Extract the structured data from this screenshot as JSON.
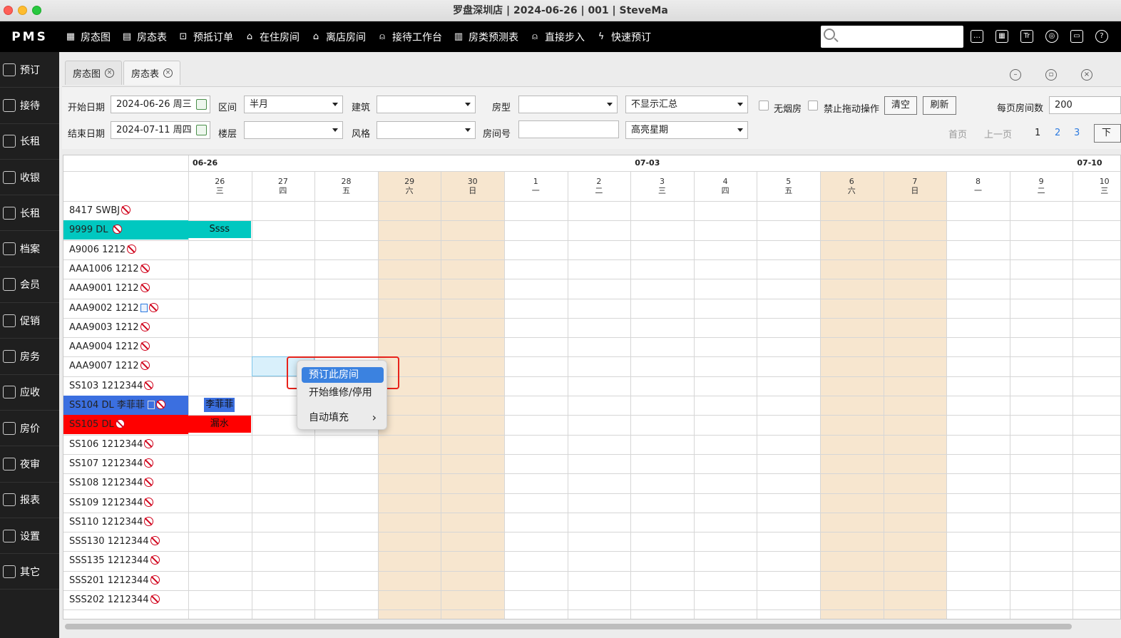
{
  "window": {
    "title": "罗盘深圳店 | 2024-06-26 | 001 | SteveMa"
  },
  "topnav": {
    "logo": "PMS",
    "items": [
      {
        "label": "房态图",
        "icon": "grid-icon",
        "glyph": "▦"
      },
      {
        "label": "房态表",
        "icon": "document-icon",
        "glyph": "▤"
      },
      {
        "label": "预抵订单",
        "icon": "inbox-icon",
        "glyph": "⊡"
      },
      {
        "label": "在住房间",
        "icon": "house-icon",
        "glyph": "⌂"
      },
      {
        "label": "离店房间",
        "icon": "house-out-icon",
        "glyph": "⌂"
      },
      {
        "label": "接待工作台",
        "icon": "reception-icon",
        "glyph": "⍝"
      },
      {
        "label": "房类预测表",
        "icon": "calendar-icon",
        "glyph": "▥"
      },
      {
        "label": "直接步入",
        "icon": "walk-in-icon",
        "glyph": "⍝"
      },
      {
        "label": "快速预订",
        "icon": "lightning-icon",
        "glyph": "ϟ"
      }
    ],
    "right_icons": [
      "message-icon",
      "calculator-icon",
      "font-icon",
      "globe-icon",
      "lock-icon",
      "help-icon"
    ]
  },
  "sidebar": {
    "items": [
      "预订",
      "接待",
      "长租",
      "收银",
      "长租",
      "档案",
      "会员",
      "促销",
      "房务",
      "应收",
      "房价",
      "夜审",
      "报表",
      "设置",
      "其它"
    ]
  },
  "tabs": [
    {
      "label": "房态图",
      "active": false
    },
    {
      "label": "房态表",
      "active": true
    }
  ],
  "filters": {
    "start_date_label": "开始日期",
    "start_date": "2024-06-26 周三",
    "end_date_label": "结束日期",
    "end_date": "2024-07-11 周四",
    "range_label": "区间",
    "range": "半月",
    "floor_label": "楼层",
    "floor": "",
    "building_label": "建筑",
    "building": "",
    "style_label": "风格",
    "style": "",
    "roomtype_label": "房型",
    "roomtype": "",
    "roomno_label": "房间号",
    "roomno": "",
    "summary": "不显示汇总",
    "highlight": "高亮星期",
    "no_smoking_label": "无烟房",
    "no_drag_label": "禁止拖动操作",
    "clear_btn": "清空",
    "refresh_btn": "刷新",
    "per_page_label": "每页房间数",
    "per_page": "200",
    "first_page": "首页",
    "prev_page": "上一页",
    "pages": [
      "1",
      "2",
      "3"
    ],
    "next_page": "下"
  },
  "grid": {
    "weeks": [
      "06-26",
      "07-03",
      "07-10"
    ],
    "days": [
      {
        "d": "26",
        "w": "三",
        "weekend": false
      },
      {
        "d": "27",
        "w": "四",
        "weekend": false
      },
      {
        "d": "28",
        "w": "五",
        "weekend": false
      },
      {
        "d": "29",
        "w": "六",
        "weekend": true
      },
      {
        "d": "30",
        "w": "日",
        "weekend": true
      },
      {
        "d": "1",
        "w": "一",
        "weekend": false
      },
      {
        "d": "2",
        "w": "二",
        "weekend": false
      },
      {
        "d": "3",
        "w": "三",
        "weekend": false
      },
      {
        "d": "4",
        "w": "四",
        "weekend": false
      },
      {
        "d": "5",
        "w": "五",
        "weekend": false
      },
      {
        "d": "6",
        "w": "六",
        "weekend": true
      },
      {
        "d": "7",
        "w": "日",
        "weekend": true
      },
      {
        "d": "8",
        "w": "一",
        "weekend": false
      },
      {
        "d": "9",
        "w": "二",
        "weekend": false
      },
      {
        "d": "10",
        "w": "三",
        "weekend": false
      }
    ],
    "rooms": [
      {
        "name": "8417 SWBJ",
        "bg": ""
      },
      {
        "name": "9999 DL ",
        "bg": "#00c8c0"
      },
      {
        "name": "A9006 1212",
        "bg": ""
      },
      {
        "name": "AAA1006 1212",
        "bg": ""
      },
      {
        "name": "AAA9001 1212",
        "bg": ""
      },
      {
        "name": "AAA9002 1212",
        "bg": "",
        "note": true
      },
      {
        "name": "AAA9003 1212",
        "bg": ""
      },
      {
        "name": "AAA9004 1212",
        "bg": ""
      },
      {
        "name": "AAA9007 1212",
        "bg": ""
      },
      {
        "name": "SS103 1212344",
        "bg": ""
      },
      {
        "name": "SS104 DL  李菲菲",
        "bg": "#3b6fe0",
        "trash": true
      },
      {
        "name": "SS105 DL",
        "bg": "#ff0000"
      },
      {
        "name": "SS106 1212344",
        "bg": ""
      },
      {
        "name": "SS107 1212344",
        "bg": ""
      },
      {
        "name": "SS108 1212344",
        "bg": ""
      },
      {
        "name": "SS109 1212344",
        "bg": ""
      },
      {
        "name": "SS110 1212344",
        "bg": ""
      },
      {
        "name": "SSS130 1212344",
        "bg": ""
      },
      {
        "name": "SSS135 1212344",
        "bg": ""
      },
      {
        "name": "SSS201 1212344",
        "bg": ""
      },
      {
        "name": "SSS202 1212344",
        "bg": ""
      }
    ],
    "bookings": [
      {
        "row": 1,
        "col": 0,
        "label": "Ssss",
        "bg": "#00c8c0",
        "color": "#111"
      },
      {
        "row": 10,
        "col": 0,
        "label": "李菲菲",
        "bg": "#3b6fe0",
        "color": "#111"
      },
      {
        "row": 11,
        "col": 0,
        "label": "漏水",
        "bg": "#ff0000",
        "color": "#111"
      }
    ],
    "selected_cell": {
      "row": 8,
      "col": 1
    }
  },
  "context_menu": {
    "items": [
      "预订此房间",
      "开始维修/停用",
      "自动填充"
    ]
  }
}
